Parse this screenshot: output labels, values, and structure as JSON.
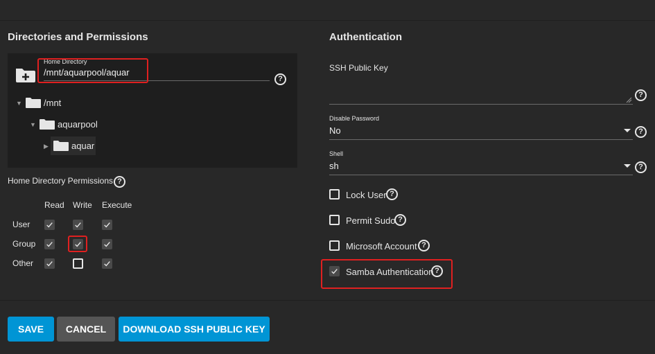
{
  "left": {
    "title": "Directories and Permissions",
    "home_dir": {
      "label": "Home Directory",
      "value": "/mnt/aquarpool/aquar"
    },
    "tree": [
      {
        "label": "/mnt",
        "caret": "▼"
      },
      {
        "label": "aquarpool",
        "caret": "▼"
      },
      {
        "label": "aquar",
        "caret": "▶"
      }
    ],
    "permissions": {
      "title": "Home Directory Permissions",
      "columns": [
        "Read",
        "Write",
        "Execute"
      ],
      "rows": [
        {
          "label": "User",
          "values": [
            true,
            true,
            true
          ]
        },
        {
          "label": "Group",
          "values": [
            true,
            true,
            true
          ]
        },
        {
          "label": "Other",
          "values": [
            true,
            false,
            true
          ]
        }
      ]
    }
  },
  "right": {
    "title": "Authentication",
    "ssh_key": {
      "label": "SSH Public Key",
      "value": ""
    },
    "disable_password": {
      "label": "Disable Password",
      "value": "No"
    },
    "shell": {
      "label": "Shell",
      "value": "sh"
    },
    "checkboxes": [
      {
        "label": "Lock User",
        "checked": false
      },
      {
        "label": "Permit Sudo",
        "checked": false
      },
      {
        "label": "Microsoft Account",
        "checked": false
      },
      {
        "label": "Samba Authentication",
        "checked": true
      }
    ]
  },
  "buttons": {
    "save": "SAVE",
    "cancel": "CANCEL",
    "download": "DOWNLOAD SSH PUBLIC KEY"
  },
  "icons": {
    "help": "?"
  },
  "colors": {
    "accent": "#0095d5",
    "highlight": "#e02020",
    "background": "#282828"
  }
}
